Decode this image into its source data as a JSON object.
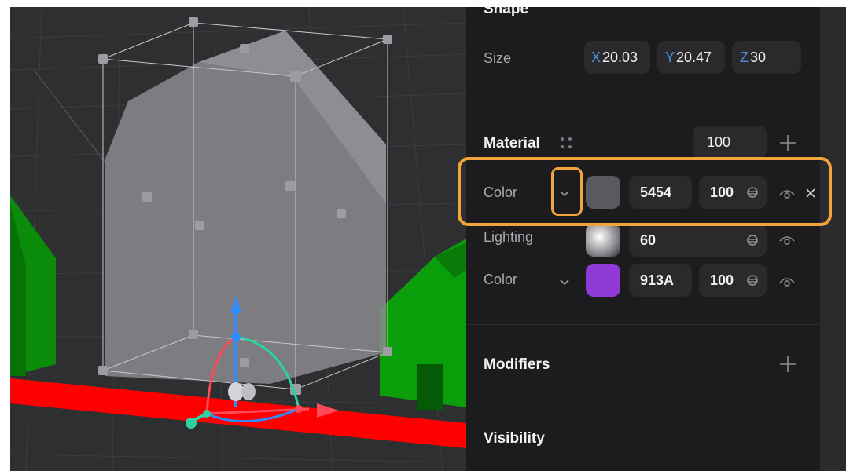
{
  "panel": {
    "shape_title": "Shape",
    "size": {
      "label": "Size",
      "x": {
        "axis": "X",
        "value": "20.03"
      },
      "y": {
        "axis": "Y",
        "value": "20.47"
      },
      "z": {
        "axis": "Z",
        "value": "30"
      }
    },
    "material": {
      "title": "Material",
      "opacity": "100",
      "layers": [
        {
          "label": "Color",
          "hex": "5454",
          "opacity": "100",
          "swatch": "#5a5a5e",
          "selected": true
        },
        {
          "label": "Lighting",
          "value": "60"
        },
        {
          "label": "Color",
          "hex": "913A",
          "opacity": "100",
          "swatch": "#8f3ad6"
        }
      ]
    },
    "modifiers_title": "Modifiers",
    "visibility_title": "Visibility"
  },
  "icons": {
    "grip": "grip-dots-icon",
    "add": "plus-icon",
    "chevron": "chevron-down-icon",
    "opacity": "opacity-drop-icon",
    "eye": "eye-icon",
    "close": "close-icon"
  },
  "colors": {
    "highlight": "#f2a33a",
    "axis_blue": "#4d8fe6",
    "ground_red": "#ff0000",
    "house_green": "#0a9e0a",
    "gizmo_teal": "#29d4a0",
    "gizmo_blue": "#2f8cff",
    "gizmo_red": "#ff4a5a"
  }
}
